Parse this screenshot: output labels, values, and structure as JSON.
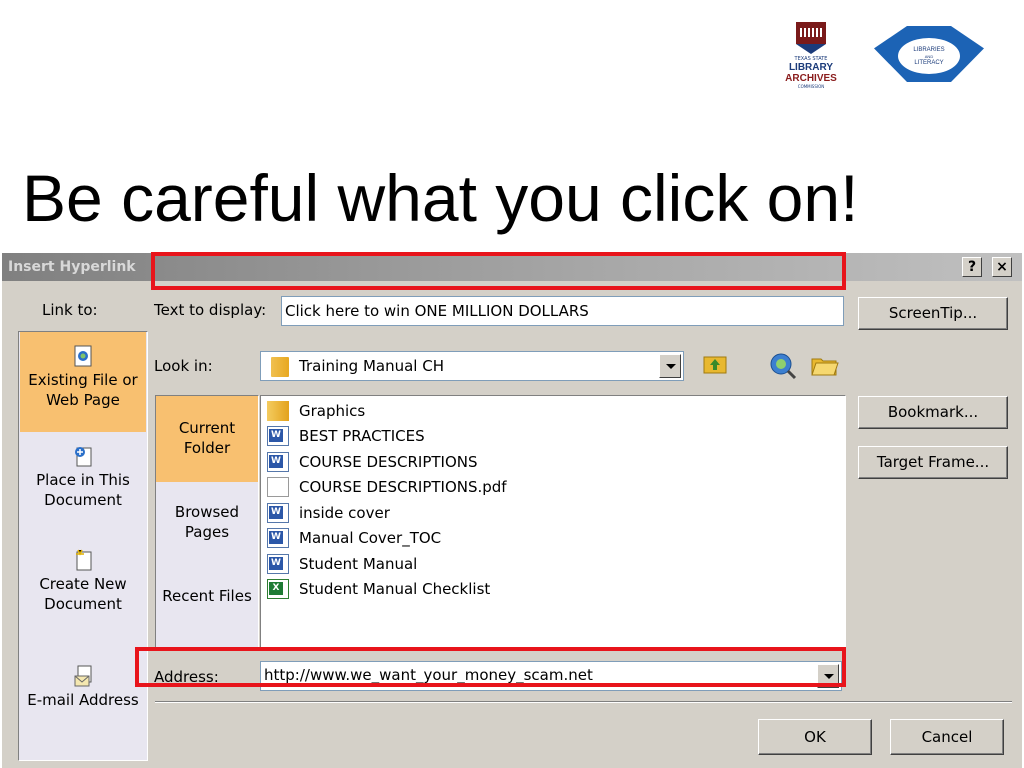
{
  "logos": {
    "tslac": {
      "line1": "TEXAS STATE",
      "line2": "LIBRARY",
      "line3": "ARCHIVES",
      "line4": "COMMISSION"
    },
    "literacy": {
      "line1": "LIBRARIES",
      "line2": "AND",
      "line3": "LITERACY"
    }
  },
  "slide": {
    "title": "Be careful what you click on!"
  },
  "dialog": {
    "title": "Insert Hyperlink",
    "help_button": "?",
    "close_button": "×",
    "link_to_label": "Link to:",
    "places": [
      {
        "label": "Existing File or Web Page",
        "active": true
      },
      {
        "label": "Place in This Document",
        "active": false
      },
      {
        "label": "Create New Document",
        "active": false
      },
      {
        "label": "E-mail Address",
        "active": false
      }
    ],
    "text_to_display_label": "Text to display:",
    "text_to_display_value": "Click here to win ONE MILLION DOLLARS",
    "screentip_button": "ScreenTip...",
    "look_in_label": "Look in:",
    "look_in_value": "Training Manual CH",
    "subnav": [
      {
        "label": "Current Folder",
        "active": true
      },
      {
        "label": "Browsed Pages",
        "active": false
      },
      {
        "label": "Recent Files",
        "active": false
      }
    ],
    "files": [
      {
        "name": "Graphics",
        "type": "folder"
      },
      {
        "name": "BEST PRACTICES",
        "type": "word"
      },
      {
        "name": "COURSE DESCRIPTIONS",
        "type": "word"
      },
      {
        "name": "COURSE DESCRIPTIONS.pdf",
        "type": "pdf"
      },
      {
        "name": "inside cover",
        "type": "word"
      },
      {
        "name": "Manual Cover_TOC",
        "type": "word"
      },
      {
        "name": "Student Manual",
        "type": "word"
      },
      {
        "name": "Student Manual Checklist",
        "type": "excel"
      }
    ],
    "bookmark_button": "Bookmark...",
    "target_frame_button": "Target Frame...",
    "address_label": "Address:",
    "address_value": "http://www.we_want_your_money_scam.net",
    "ok_button": "OK",
    "cancel_button": "Cancel"
  },
  "colors": {
    "highlight": "#e8141b",
    "active_place": "#f8c070"
  }
}
